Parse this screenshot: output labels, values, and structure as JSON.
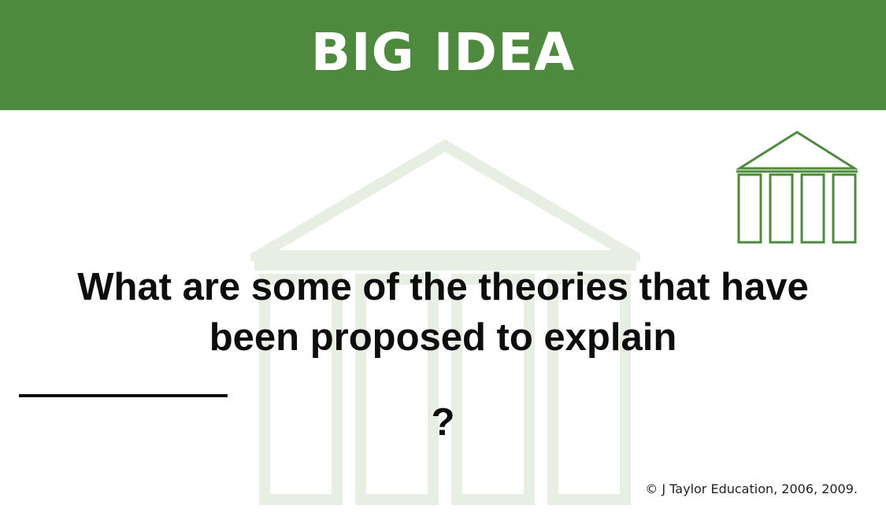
{
  "banner": {
    "title": "BIG IDEA"
  },
  "question": {
    "line1": "What are some of the theories that have",
    "line2_prefix": "been proposed to explain",
    "line2_suffix": "?"
  },
  "footer": {
    "copyright": "© J Taylor Education, 2006, 2009."
  },
  "icons": {
    "watermark": "temple-watermark-icon",
    "corner": "temple-icon"
  },
  "colors": {
    "banner": "#4e8a3e",
    "watermark": "#e6efe1",
    "icon": "#4e8a3e"
  }
}
